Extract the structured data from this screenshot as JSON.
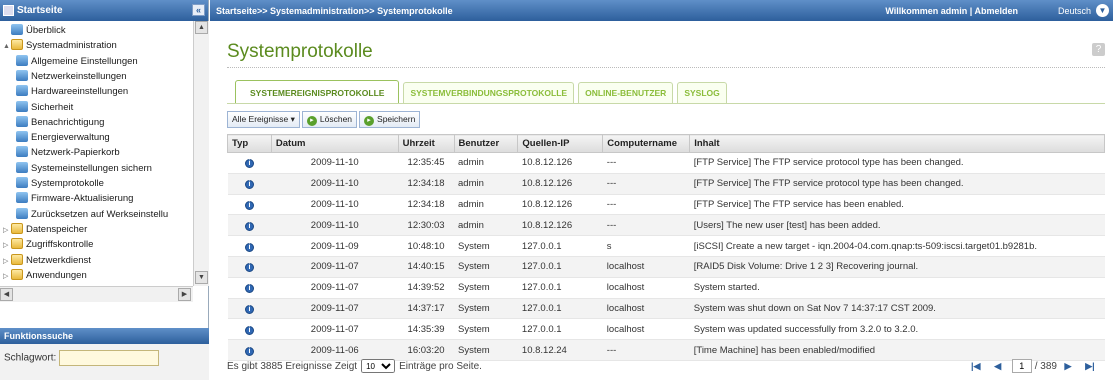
{
  "sidebar": {
    "title": "Startseite",
    "collapse": "«",
    "items": [
      {
        "label": "Überblick",
        "icon": "overview-icon",
        "level": 0,
        "arrow": ""
      },
      {
        "label": "Systemadministration",
        "icon": "folder-open-icon",
        "level": 0,
        "arrow": "▲"
      },
      {
        "label": "Allgemeine Einstellungen",
        "icon": "settings-icon",
        "level": 1,
        "arrow": ""
      },
      {
        "label": "Netzwerkeinstellungen",
        "icon": "network-icon",
        "level": 1,
        "arrow": ""
      },
      {
        "label": "Hardwareeinstellungen",
        "icon": "hardware-icon",
        "level": 1,
        "arrow": ""
      },
      {
        "label": "Sicherheit",
        "icon": "security-icon",
        "level": 1,
        "arrow": ""
      },
      {
        "label": "Benachrichtigung",
        "icon": "notification-icon",
        "level": 1,
        "arrow": ""
      },
      {
        "label": "Energieverwaltung",
        "icon": "power-icon",
        "level": 1,
        "arrow": ""
      },
      {
        "label": "Netzwerk-Papierkorb",
        "icon": "recycle-bin-icon",
        "level": 1,
        "arrow": ""
      },
      {
        "label": "Systemeinstellungen sichern",
        "icon": "backup-icon",
        "level": 1,
        "arrow": ""
      },
      {
        "label": "Systemprotokolle",
        "icon": "logs-icon",
        "level": 1,
        "arrow": ""
      },
      {
        "label": "Firmware-Aktualisierung",
        "icon": "firmware-icon",
        "level": 1,
        "arrow": ""
      },
      {
        "label": "Zurücksetzen auf Werkseinstellu",
        "icon": "reset-icon",
        "level": 1,
        "arrow": ""
      },
      {
        "label": "Datenspeicher",
        "icon": "folder-icon",
        "level": 0,
        "arrow": "▷"
      },
      {
        "label": "Zugriffskontrolle",
        "icon": "folder-icon",
        "level": 0,
        "arrow": "▷"
      },
      {
        "label": "Netzwerkdienst",
        "icon": "folder-icon",
        "level": 0,
        "arrow": "▷"
      },
      {
        "label": "Anwendungen",
        "icon": "folder-icon",
        "level": 0,
        "arrow": "▷"
      }
    ]
  },
  "search": {
    "title": "Funktionssuche",
    "label": "Schlagwort:",
    "value": ""
  },
  "topbar": {
    "breadcrumb": "Startseite>> Systemadministration>> Systemprotokolle",
    "welcome": "Willkommen admin | Abmelden",
    "language": "Deutsch"
  },
  "page": {
    "title": "Systemprotokolle",
    "help": "?"
  },
  "tabs": [
    "SYSTEMEREIGNISPROTOKOLLE",
    "SYSTEMVERBINDUNGSPROTOKOLLE",
    "ONLINE-BENUTZER",
    "SYSLOG"
  ],
  "toolbar": {
    "filter": "Alle Ereignisse",
    "delete": "Löschen",
    "save": "Speichern"
  },
  "table": {
    "headers": [
      "Typ",
      "Datum",
      "Uhrzeit",
      "Benutzer",
      "Quellen-IP",
      "Computername",
      "Inhalt"
    ],
    "rows": [
      [
        "i",
        "2009-11-10",
        "12:35:45",
        "admin",
        "10.8.12.126",
        "---",
        "[FTP Service] The FTP service protocol type has been changed."
      ],
      [
        "i",
        "2009-11-10",
        "12:34:18",
        "admin",
        "10.8.12.126",
        "---",
        "[FTP Service] The FTP service protocol type has been changed."
      ],
      [
        "i",
        "2009-11-10",
        "12:34:18",
        "admin",
        "10.8.12.126",
        "---",
        "[FTP Service] The FTP service has been enabled."
      ],
      [
        "i",
        "2009-11-10",
        "12:30:03",
        "admin",
        "10.8.12.126",
        "---",
        "[Users] The new user [test] has been added."
      ],
      [
        "i",
        "2009-11-09",
        "10:48:10",
        "System",
        "127.0.0.1",
        "s",
        "[iSCSI] Create a new target - iqn.2004-04.com.qnap:ts-509:iscsi.target01.b9281b."
      ],
      [
        "i",
        "2009-11-07",
        "14:40:15",
        "System",
        "127.0.0.1",
        "localhost",
        "[RAID5 Disk Volume: Drive 1 2 3] Recovering journal."
      ],
      [
        "i",
        "2009-11-07",
        "14:39:52",
        "System",
        "127.0.0.1",
        "localhost",
        "System started."
      ],
      [
        "i",
        "2009-11-07",
        "14:37:17",
        "System",
        "127.0.0.1",
        "localhost",
        "System was shut down on Sat Nov 7 14:37:17 CST 2009."
      ],
      [
        "i",
        "2009-11-07",
        "14:35:39",
        "System",
        "127.0.0.1",
        "localhost",
        "System was updated successfully from 3.2.0 to 3.2.0."
      ],
      [
        "i",
        "2009-11-06",
        "16:03:20",
        "System",
        "10.8.12.24",
        "---",
        "[Time Machine] has been enabled/modified"
      ]
    ]
  },
  "footer": {
    "prefix": "Es gibt 3885 Ereignisse Zeigt",
    "per_page": "10",
    "suffix": "Einträge pro Seite.",
    "page": "1",
    "total": "/ 389"
  },
  "colors": {
    "accent": "#5b8b1f",
    "header_bar": "#2d5f9c",
    "info": "#2f67b3"
  }
}
